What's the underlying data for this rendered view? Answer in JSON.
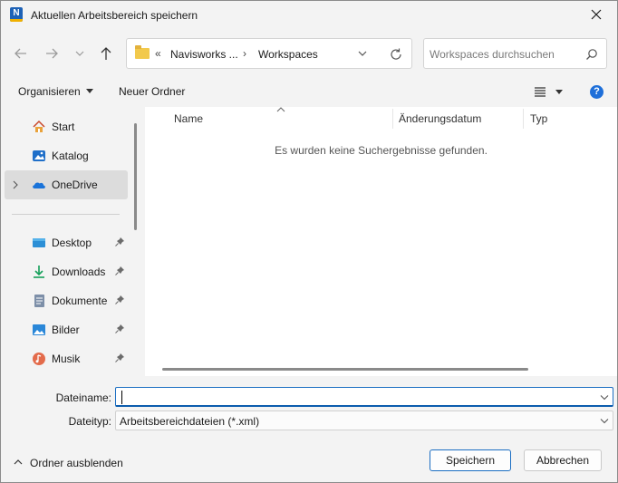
{
  "window": {
    "title": "Aktuellen Arbeitsbereich speichern",
    "app_icon_letter": "N"
  },
  "address_bar": {
    "overflow_glyph": "«",
    "crumbs": [
      "Navisworks ...",
      "Workspaces"
    ],
    "separator": "›"
  },
  "search": {
    "placeholder": "Workspaces durchsuchen"
  },
  "toolbar": {
    "organize_label": "Organisieren",
    "new_folder_label": "Neuer Ordner",
    "help_glyph": "?"
  },
  "nav_pane": {
    "items": [
      {
        "label": "Start",
        "icon": "home-icon"
      },
      {
        "label": "Katalog",
        "icon": "gallery-icon"
      },
      {
        "label": "OneDrive",
        "icon": "onedrive-cloud-icon",
        "selected": true
      },
      {
        "label": "Desktop",
        "icon": "desktop-icon",
        "pinned": true
      },
      {
        "label": "Downloads",
        "icon": "download-icon",
        "pinned": true
      },
      {
        "label": "Dokumente",
        "icon": "documents-icon",
        "pinned": true
      },
      {
        "label": "Bilder",
        "icon": "pictures-icon",
        "pinned": true
      },
      {
        "label": "Musik",
        "icon": "music-icon",
        "pinned": true
      }
    ]
  },
  "file_list": {
    "columns": [
      "Name",
      "Änderungsdatum",
      "Typ"
    ],
    "empty_message": "Es wurden keine Suchergebnisse gefunden."
  },
  "form": {
    "filename_label": "Dateiname:",
    "filename_value": "",
    "filetype_label": "Dateityp:",
    "filetype_value": "Arbeitsbereichdateien (*.xml)"
  },
  "footer": {
    "hide_folders_label": "Ordner ausblenden",
    "save_label": "Speichern",
    "cancel_label": "Abbrechen"
  },
  "colors": {
    "accent": "#1b6ec2",
    "selected_bg": "#dcdcdc",
    "window_bg": "#f3f3f3"
  }
}
